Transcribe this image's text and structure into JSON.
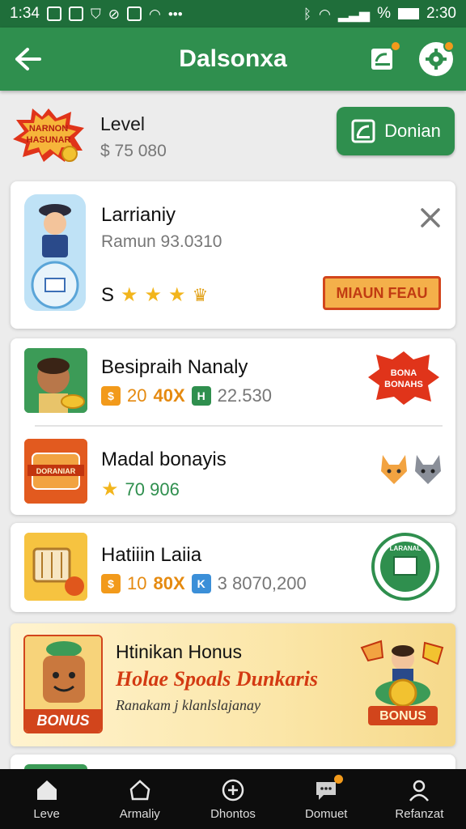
{
  "status_bar": {
    "time_left": "1:34",
    "battery": "%",
    "time_right": "2:30"
  },
  "app_bar": {
    "title": "Dalsonxa"
  },
  "level_header": {
    "label": "Level",
    "value": "$ 75 080",
    "badge_text": "NARNON HASUNAR",
    "donate_label": "Donian"
  },
  "featured_card": {
    "title": "Larrianiy",
    "subtitle": "Ramun 93.0310",
    "rating_prefix": "S",
    "stars": 3,
    "cta_label": "MIAUN FEAU"
  },
  "list_items": [
    {
      "title": "Besipraih Nanaly",
      "chip1_label": "20",
      "chip1_value": "20",
      "multiplier": "40X",
      "chip2_label": "H",
      "amount": "22.530",
      "badge": "BONA BONAHS"
    },
    {
      "title": "Madal bonayis",
      "value": "70 906",
      "banner_text": "DORANIAR"
    },
    {
      "title": "Hatiiin Laiia",
      "chip1_label": "80",
      "chip1_value": "10",
      "multiplier": "80X",
      "chip2_label": "K",
      "amount": "3 8070,200",
      "seal_text": "LARANAL"
    }
  ],
  "promo": {
    "title": "Htinikan Honus",
    "headline": "Holae Spoals Dunkaris",
    "subtitle": "Ranakam j klanlslajanay",
    "left_badge": "BONUS",
    "right_badge": "BONUS"
  },
  "bottom_nav": [
    {
      "label": "Leve",
      "icon": "home-icon"
    },
    {
      "label": "Armaliy",
      "icon": "house-outline-icon"
    },
    {
      "label": "Dhontos",
      "icon": "plus-circle-icon"
    },
    {
      "label": "Domuet",
      "icon": "chat-icon"
    },
    {
      "label": "Refanzat",
      "icon": "person-icon"
    }
  ],
  "colors": {
    "primary": "#2f8f4e",
    "status_bar": "#1f6e3a",
    "accent": "#f29a1b",
    "promo_red": "#d33a12"
  }
}
